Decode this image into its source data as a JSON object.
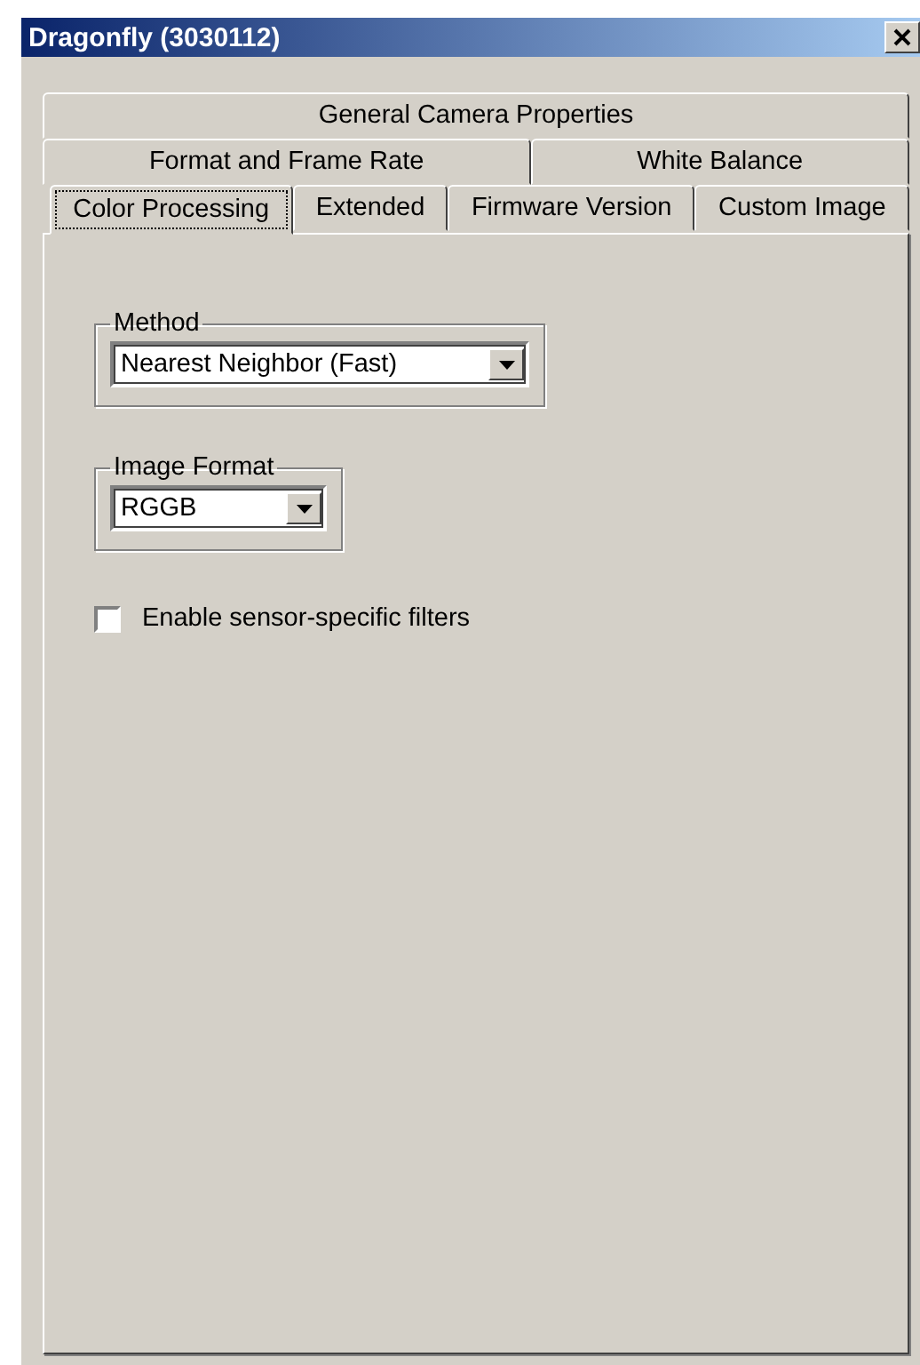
{
  "window": {
    "title": "Dragonfly (3030112)"
  },
  "tab_rows": [
    [
      {
        "label": "General Camera Properties",
        "selected": false
      }
    ],
    [
      {
        "label": "Format and Frame Rate",
        "selected": false
      },
      {
        "label": "White Balance",
        "selected": false
      }
    ],
    [
      {
        "label": "Color Processing",
        "selected": true
      },
      {
        "label": "Extended",
        "selected": false
      },
      {
        "label": "Firmware Version",
        "selected": false
      },
      {
        "label": "Custom Image",
        "selected": false
      }
    ]
  ],
  "groups": [
    {
      "legend": "Method",
      "value": "Nearest Neighbor (Fast)",
      "kind": "wide"
    },
    {
      "legend": "Image Format",
      "value": "RGGB",
      "kind": "narrow"
    }
  ],
  "checkbox": {
    "label": "Enable sensor-specific filters",
    "checked": false
  }
}
